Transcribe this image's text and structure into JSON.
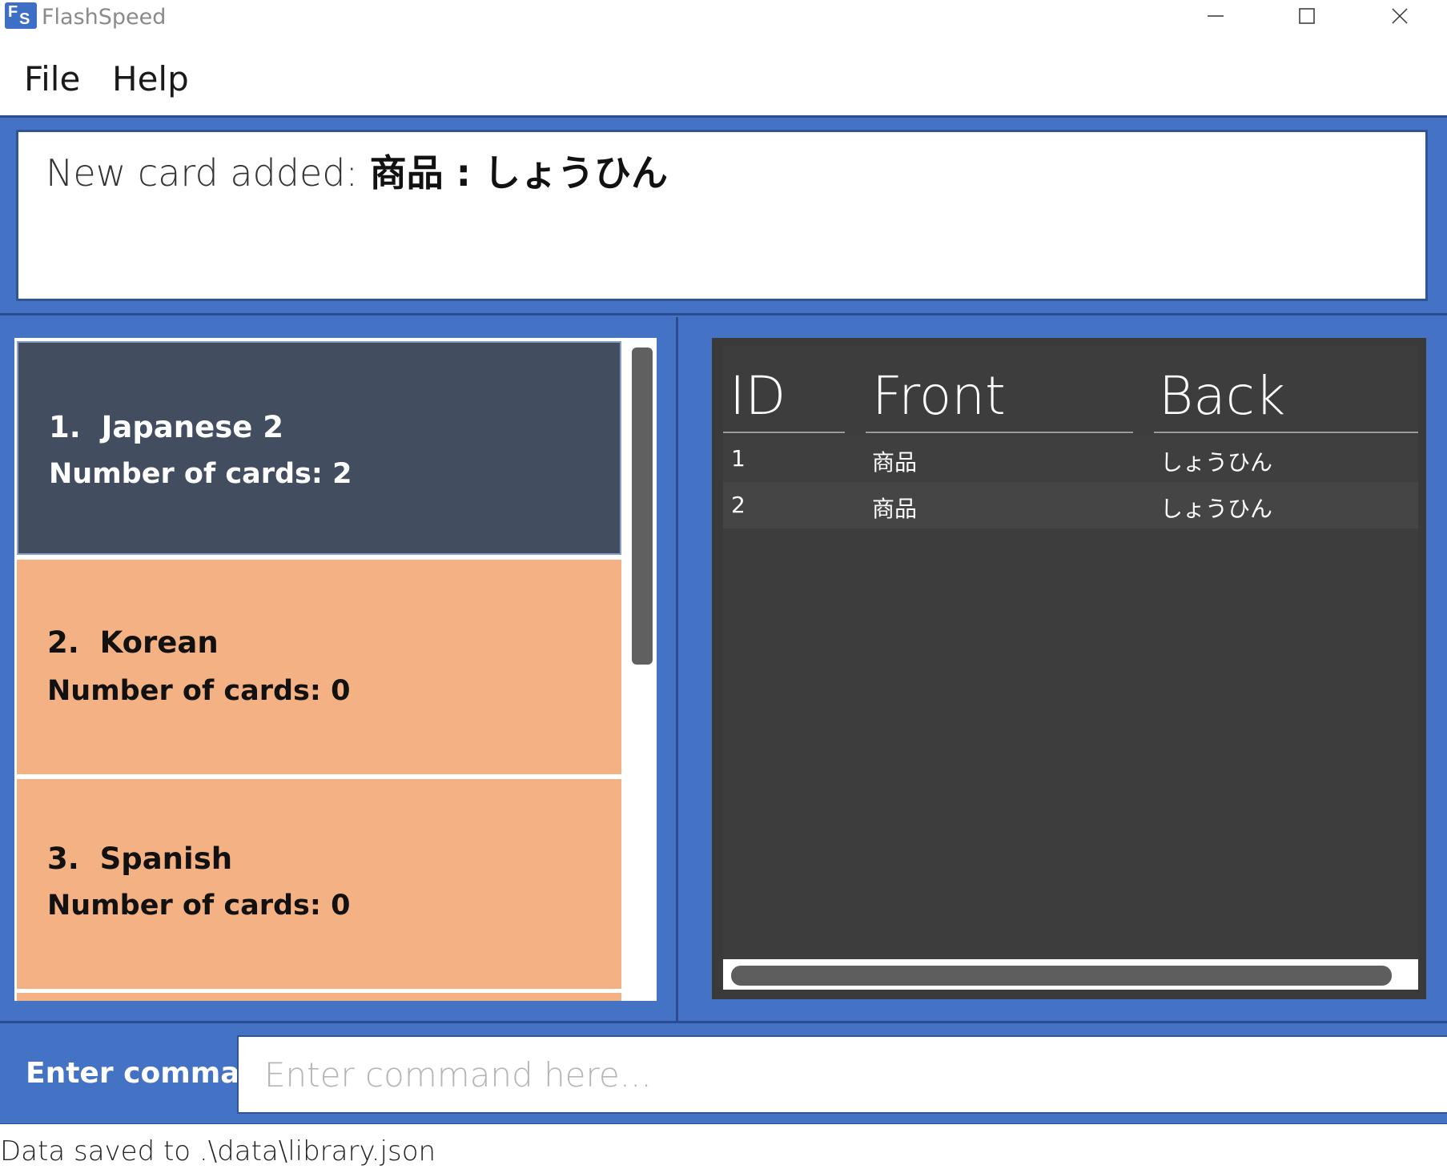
{
  "window": {
    "title": "FlashSpeed",
    "icon_letters": [
      "F",
      "S"
    ],
    "controls": {
      "minimize": "minimize-icon",
      "maximize": "maximize-icon",
      "close": "close-icon"
    }
  },
  "menu": {
    "file": "File",
    "help": "Help"
  },
  "result": {
    "label": "New card added: ",
    "card": "商品 : しょうひん"
  },
  "decks": [
    {
      "index": "1.",
      "name": "Japanese 2",
      "count": "Number of cards: 2",
      "selected": true
    },
    {
      "index": "2.",
      "name": "Korean",
      "count": "Number of cards: 0",
      "selected": false
    },
    {
      "index": "3.",
      "name": "Spanish",
      "count": "Number of cards: 0",
      "selected": false
    }
  ],
  "card_table": {
    "headers": {
      "id": "ID",
      "front": "Front",
      "back": "Back"
    },
    "rows": [
      {
        "id": "1",
        "front": "商品",
        "back": "しょうひん"
      },
      {
        "id": "2",
        "front": "商品",
        "back": "しょうひん"
      }
    ]
  },
  "command": {
    "label": "Enter comma...",
    "placeholder": "Enter command here...",
    "value": ""
  },
  "status": {
    "text": "Data saved to .\\data\\library.json"
  },
  "colors": {
    "app_background": "#4472c4",
    "selected_deck": "#424d5f",
    "deck": "#f4b183",
    "table_background": "#3d3d3d"
  }
}
